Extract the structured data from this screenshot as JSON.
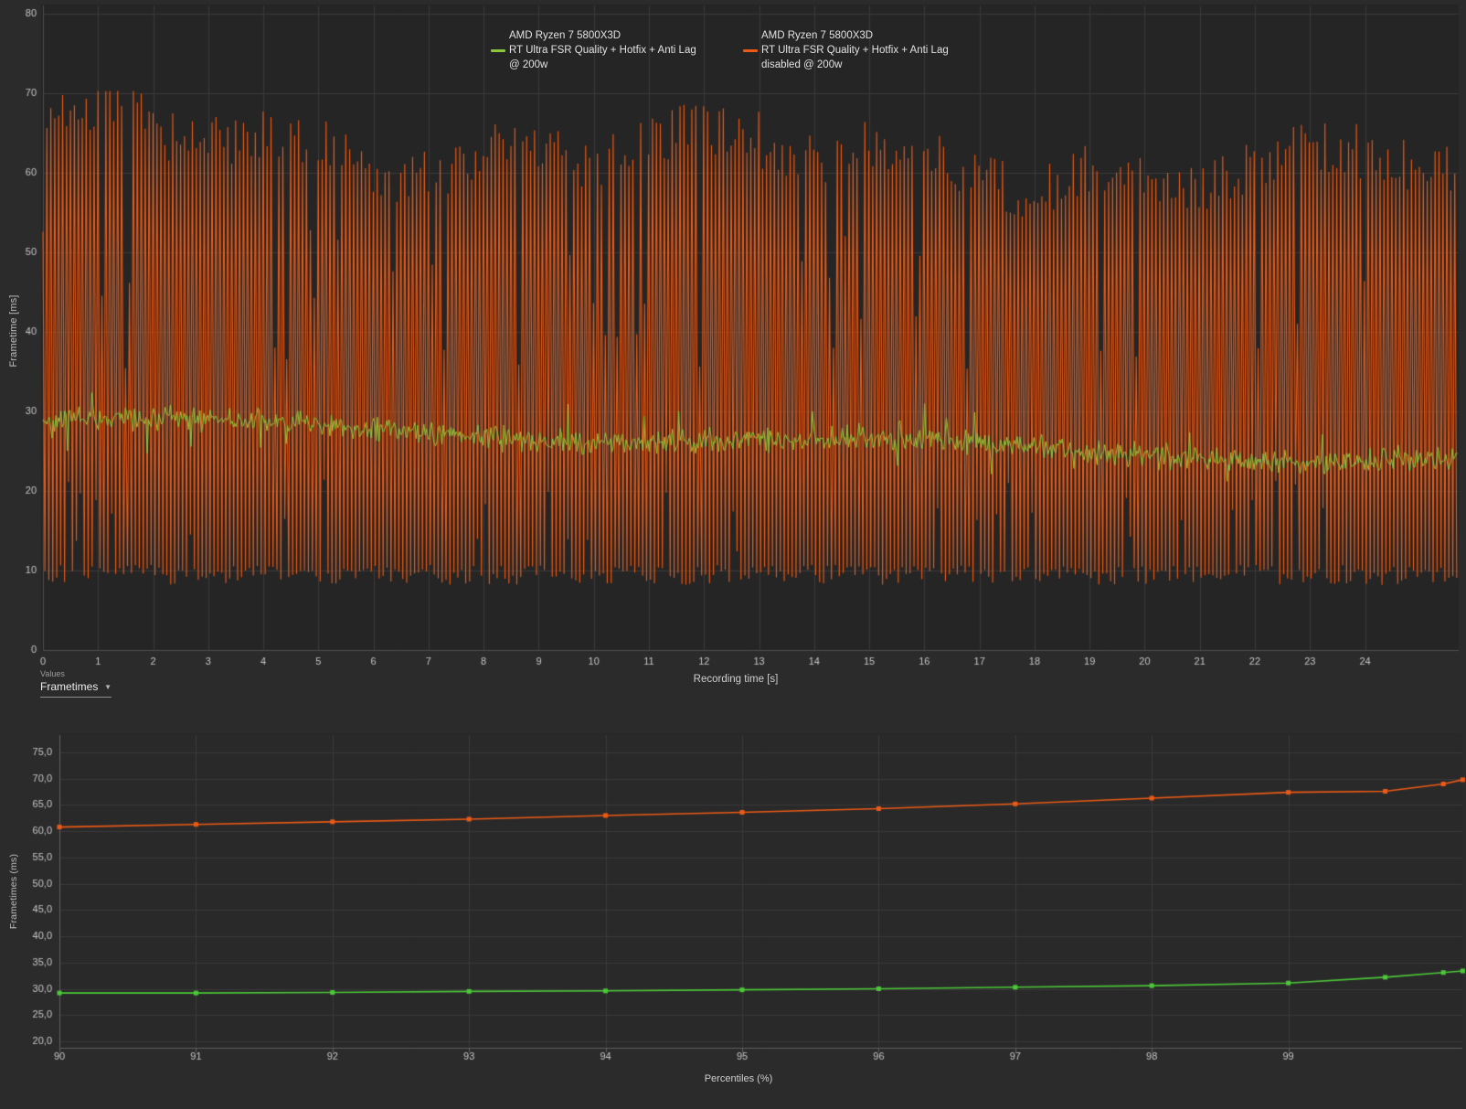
{
  "colors": {
    "page_bg": "#2b2b2b",
    "plot_bg": "#252525",
    "grid": "#3a3a3a",
    "axis_line": "#5f5f5f",
    "tick_text": "#c7c7c7",
    "green_top": "#8cc63c",
    "green_bottom": "#4cc838",
    "orange": "#ed5a16"
  },
  "top_chart": {
    "ylabel": "Frametime [ms]",
    "xlabel": "Recording time [s]",
    "legend": [
      {
        "line1": "AMD Ryzen 7 5800X3D",
        "line2": "RT Ultra FSR Quality + Hotfix + Anti Lag",
        "line3": "@ 200w"
      },
      {
        "line1": "AMD Ryzen 7 5800X3D",
        "line2": "RT Ultra FSR Quality + Hotfix + Anti Lag",
        "line3": "disabled @ 200w"
      }
    ]
  },
  "values_panel": {
    "label": "Values",
    "selected": "Frametimes"
  },
  "bottom_chart": {
    "ylabel": "Frametimes (ms)",
    "xlabel": "Percentiles (%)"
  },
  "chart_data": [
    {
      "type": "line",
      "title": "Frametimes over recording time",
      "xlabel": "Recording time [s]",
      "ylabel": "Frametime [ms]",
      "xlim": [
        0,
        25.7
      ],
      "ylim": [
        0,
        80
      ],
      "x_ticks": [
        0,
        1,
        2,
        3,
        4,
        5,
        6,
        7,
        8,
        9,
        10,
        11,
        12,
        13,
        14,
        15,
        16,
        17,
        18,
        19,
        20,
        21,
        22,
        23,
        24
      ],
      "y_ticks": [
        0,
        10,
        20,
        30,
        40,
        50,
        60,
        70,
        80
      ],
      "grid": true,
      "legend_position": "top-center",
      "series": [
        {
          "name": "AMD Ryzen 7 5800X3D RT Ultra FSR Quality + Hotfix + Anti Lag @ 200w",
          "color": "#8cc63c",
          "behavior": "stable frametime line, about 29 ms at start gradually declining to about 24 ms at end, noise +/- 2 ms",
          "generator": {
            "seed": 42,
            "n": 1100,
            "mean_start": 28.9,
            "slope": 0.2,
            "wobble": 0.7,
            "noise": 1.8
          }
        },
        {
          "name": "AMD Ryzen 7 5800X3D RT Ultra FSR Quality + Hotfix + Anti Lag disabled @ 200w",
          "color": "#ed5a16",
          "behavior": "severe stutter oscillation alternating every frame between ~8-12 ms lows and ~55-70 ms highs across the whole capture",
          "generator": {
            "seed": 7,
            "cycles": 360,
            "env_base": 64.5,
            "env_slope": 0.18,
            "low_base": 8.2
          }
        }
      ]
    },
    {
      "type": "line",
      "title": "Frametime percentiles",
      "xlabel": "Percentiles (%)",
      "ylabel": "Frametimes (ms)",
      "xlim": [
        90,
        100.3
      ],
      "ylim": [
        20,
        76
      ],
      "x_ticks": [
        90,
        91,
        92,
        93,
        94,
        95,
        96,
        97,
        98,
        99
      ],
      "y_ticks": [
        20,
        25,
        30,
        35,
        40,
        45,
        50,
        55,
        60,
        65,
        70,
        75
      ],
      "percentiles": [
        90,
        91,
        92,
        93,
        94,
        95,
        96,
        97,
        98,
        99,
        99.5,
        99.8,
        99.9
      ],
      "series": [
        {
          "name": "AMD Ryzen 7 5800X3D RT Ultra FSR Quality + Hotfix + Anti Lag @ 200w",
          "color": "#4cc838",
          "values": [
            29.2,
            29.2,
            29.3,
            29.5,
            29.6,
            29.8,
            30.0,
            30.3,
            30.6,
            31.1,
            32.2,
            33.1,
            33.4
          ]
        },
        {
          "name": "AMD Ryzen 7 5800X3D RT Ultra FSR Quality + Hotfix + Anti Lag disabled @ 200w",
          "color": "#ed5a16",
          "values": [
            60.8,
            61.3,
            61.8,
            62.3,
            63.0,
            63.6,
            64.3,
            65.2,
            66.3,
            67.4,
            67.6,
            69.0,
            69.8
          ]
        }
      ]
    }
  ]
}
